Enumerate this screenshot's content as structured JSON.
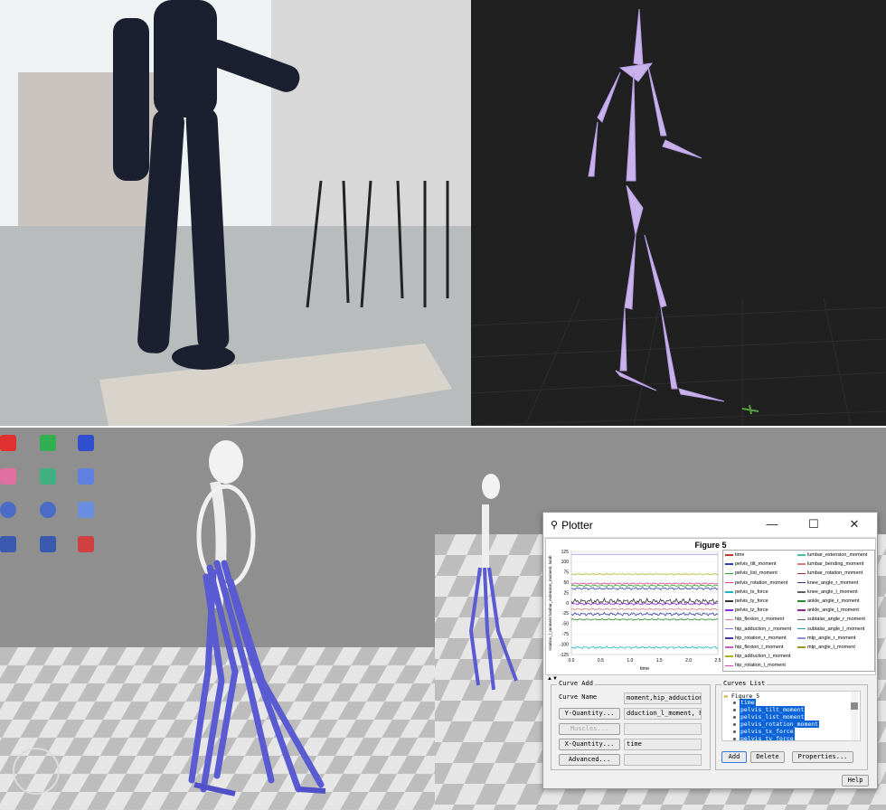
{
  "plotter": {
    "window_title": "Plotter",
    "figure_title": "Figure 5",
    "y_ticks": [
      "125",
      "100",
      "75",
      "50",
      "25",
      "0",
      "-25",
      "-50",
      "-75",
      "-100",
      "-125"
    ],
    "x_ticks": [
      "0.0",
      "0.5",
      "1.0",
      "1.5",
      "2.0",
      "2.5"
    ],
    "x_label": "time",
    "y_label": "rotation_l_moment lumbar_extension_moment, lumb",
    "legend": [
      {
        "label": "time",
        "color": "#c0392b"
      },
      {
        "label": "pelvis_tilt_moment",
        "color": "#2c3fb0"
      },
      {
        "label": "pelvis_list_moment",
        "color": "#2aa12a"
      },
      {
        "label": "pelvis_rotation_moment",
        "color": "#e0428a"
      },
      {
        "label": "pelvis_tx_force",
        "color": "#18b8c0"
      },
      {
        "label": "pelvis_ty_force",
        "color": "#333333"
      },
      {
        "label": "pelvis_tz_force",
        "color": "#8a2be2"
      },
      {
        "label": "hip_flexion_r_moment",
        "color": "#e07a7a"
      },
      {
        "label": "hip_adduction_r_moment",
        "color": "#7a7ae0"
      },
      {
        "label": "hip_rotation_r_moment",
        "color": "#3a3aa0"
      },
      {
        "label": "hip_flexion_l_moment",
        "color": "#c060c0"
      },
      {
        "label": "hip_adduction_l_moment",
        "color": "#b0b020"
      },
      {
        "label": "hip_rotation_l_moment",
        "color": "#e040c0"
      },
      {
        "label": "lumbar_extension_moment",
        "color": "#40c0a0"
      },
      {
        "label": "lumbar_bending_moment",
        "color": "#d08080"
      },
      {
        "label": "lumbar_rotation_moment",
        "color": "#a03030"
      },
      {
        "label": "knee_angle_r_moment",
        "color": "#303080"
      },
      {
        "label": "knee_angle_l_moment",
        "color": "#606060"
      },
      {
        "label": "ankle_angle_r_moment",
        "color": "#2a8a2a"
      },
      {
        "label": "ankle_angle_l_moment",
        "color": "#8a2a8a"
      },
      {
        "label": "subtalar_angle_r_moment",
        "color": "#5a5a5a"
      },
      {
        "label": "subtalar_angle_l_moment",
        "color": "#20a0a0"
      },
      {
        "label": "mtp_angle_r_moment",
        "color": "#9090e0"
      },
      {
        "label": "mtp_angle_l_moment",
        "color": "#9a9a20"
      }
    ],
    "curve_add": {
      "group_label": "Curve Add",
      "curve_name_label": "Curve Name",
      "curve_name_value": "moment,hip_adduction_",
      "y_quantity_button": "Y-Quantity...",
      "y_quantity_value": "dduction_l_moment, hi",
      "muscles_button": "Muscles...",
      "x_quantity_button": "X-Quantity...",
      "x_quantity_value": "time",
      "advanced_button": "Advanced..."
    },
    "curves_list": {
      "group_label": "Curves List",
      "root": "Figure 5",
      "items": [
        "time",
        "pelvis_tilt_moment",
        "pelvis_list_moment",
        "pelvis_rotation_moment",
        "pelvis_tx_force",
        "pelvis_ty_force"
      ],
      "add_button": "Add",
      "delete_button": "Delete",
      "properties_button": "Properties..."
    },
    "help_button": "Help"
  },
  "chart_data": {
    "type": "line",
    "title": "Figure 5",
    "xlabel": "time",
    "ylabel": "rotation_l_moment lumbar_extension_moment, lumb",
    "xlim": [
      0,
      2.5
    ],
    "ylim": [
      -125,
      125
    ],
    "series": [
      {
        "name": "time",
        "level": 118,
        "amp": 0,
        "color": "#9aa5e6"
      },
      {
        "name": "lumbar_extension_moment",
        "level": 70,
        "amp": 1,
        "color": "#b0b020"
      },
      {
        "name": "pelvis_rotation_moment",
        "level": 47,
        "amp": 2,
        "color": "#e0428a"
      },
      {
        "name": "pelvis_list_moment",
        "level": 42,
        "amp": 2,
        "color": "#2aa12a"
      },
      {
        "name": "pelvis_tilt_moment",
        "level": 35,
        "amp": 3,
        "color": "#2c3fb0"
      },
      {
        "name": "pelvis_ty_force",
        "level": 4,
        "amp": 7,
        "color": "#333333"
      },
      {
        "name": "pelvis_tz_force",
        "level": -2,
        "amp": 3,
        "color": "#8a2be2"
      },
      {
        "name": "hip_flexion_r_moment",
        "level": -15,
        "amp": 2,
        "color": "#e07a7a"
      },
      {
        "name": "hip_rotation_r_moment",
        "level": -27,
        "amp": 4,
        "color": "#3a3aa0"
      },
      {
        "name": "ankle_angle_r_moment",
        "level": -40,
        "amp": 2,
        "color": "#2a8a2a"
      },
      {
        "name": "pelvis_tx_force",
        "level": -108,
        "amp": 3,
        "color": "#18b8c0"
      }
    ]
  }
}
